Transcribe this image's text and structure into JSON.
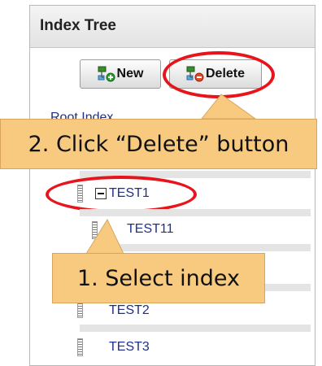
{
  "panel": {
    "title": "Index Tree"
  },
  "toolbar": {
    "new_label": "New",
    "delete_label": "Delete"
  },
  "tree": {
    "root_label": "Root Index",
    "nodes": [
      {
        "label": "TEST1",
        "level": 1,
        "selected": true,
        "expanded": true
      },
      {
        "label": "TEST11",
        "level": 2
      },
      {
        "label": "TEST2",
        "level": 1
      },
      {
        "label": "TEST3",
        "level": 1
      }
    ]
  },
  "callouts": {
    "step2": "2. Click “Delete” button",
    "step1": "1. Select index"
  },
  "colors": {
    "highlight_oval": "#e8141b",
    "callout_fill": "#f7ca80",
    "link_text": "#1f2f8a"
  },
  "icons": [
    "tree-add-icon",
    "tree-delete-icon",
    "collapse-minus-icon",
    "drag-handle-icon"
  ]
}
